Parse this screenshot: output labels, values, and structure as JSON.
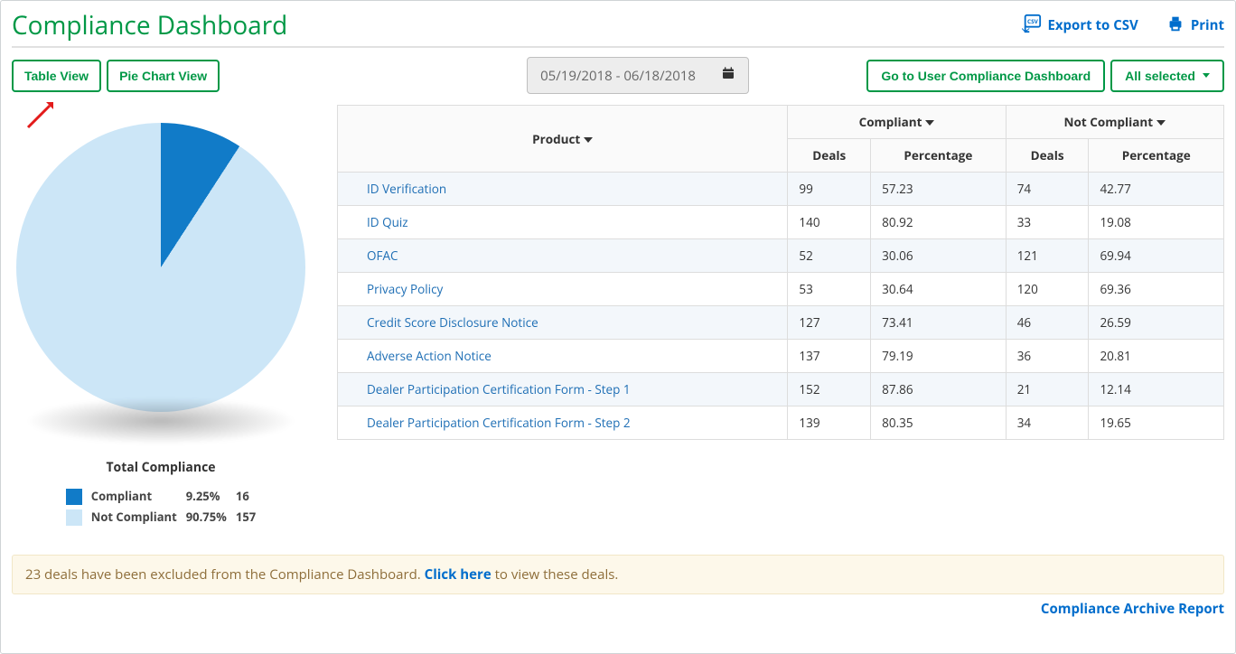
{
  "header": {
    "title": "Compliance Dashboard",
    "export_csv": "Export to CSV",
    "print": "Print"
  },
  "tabs": {
    "table_view": "Table View",
    "pie_chart_view": "Pie Chart View"
  },
  "date_range": "05/19/2018 - 06/18/2018",
  "go_user_dash": "Go to User Compliance Dashboard",
  "all_selected": "All selected",
  "table": {
    "headers": {
      "product": "Product",
      "compliant": "Compliant",
      "not_compliant": "Not Compliant",
      "deals": "Deals",
      "percentage": "Percentage"
    },
    "rows": [
      {
        "product": "ID Verification",
        "c_deals": "99",
        "c_pct": "57.23",
        "nc_deals": "74",
        "nc_pct": "42.77"
      },
      {
        "product": "ID Quiz",
        "c_deals": "140",
        "c_pct": "80.92",
        "nc_deals": "33",
        "nc_pct": "19.08"
      },
      {
        "product": "OFAC",
        "c_deals": "52",
        "c_pct": "30.06",
        "nc_deals": "121",
        "nc_pct": "69.94"
      },
      {
        "product": "Privacy Policy",
        "c_deals": "53",
        "c_pct": "30.64",
        "nc_deals": "120",
        "nc_pct": "69.36"
      },
      {
        "product": "Credit Score Disclosure Notice",
        "c_deals": "127",
        "c_pct": "73.41",
        "nc_deals": "46",
        "nc_pct": "26.59"
      },
      {
        "product": "Adverse Action Notice",
        "c_deals": "137",
        "c_pct": "79.19",
        "nc_deals": "36",
        "nc_pct": "20.81"
      },
      {
        "product": "Dealer Participation Certification Form - Step 1",
        "c_deals": "152",
        "c_pct": "87.86",
        "nc_deals": "21",
        "nc_pct": "12.14"
      },
      {
        "product": "Dealer Participation Certification Form - Step 2",
        "c_deals": "139",
        "c_pct": "80.35",
        "nc_deals": "34",
        "nc_pct": "19.65"
      }
    ]
  },
  "pie": {
    "title": "Total Compliance",
    "compliant_label": "Compliant",
    "compliant_pct": "9.25%",
    "compliant_count": "16",
    "not_compliant_label": "Not Compliant",
    "not_compliant_pct": "90.75%",
    "not_compliant_count": "157"
  },
  "colors": {
    "compliant": "#117bc8",
    "not_compliant": "#cce6f7",
    "brand_green": "#009846",
    "link_blue": "#006dcc"
  },
  "info_bar": {
    "prefix": "23 deals have been excluded from the Compliance Dashboard. ",
    "link": "Click here",
    "suffix": " to view these deals."
  },
  "footer_link": "Compliance Archive Report",
  "chart_data": {
    "type": "pie",
    "title": "Total Compliance",
    "series": [
      {
        "name": "Compliant",
        "value": 16,
        "percentage": 9.25,
        "color": "#117bc8"
      },
      {
        "name": "Not Compliant",
        "value": 157,
        "percentage": 90.75,
        "color": "#cce6f7"
      }
    ]
  }
}
